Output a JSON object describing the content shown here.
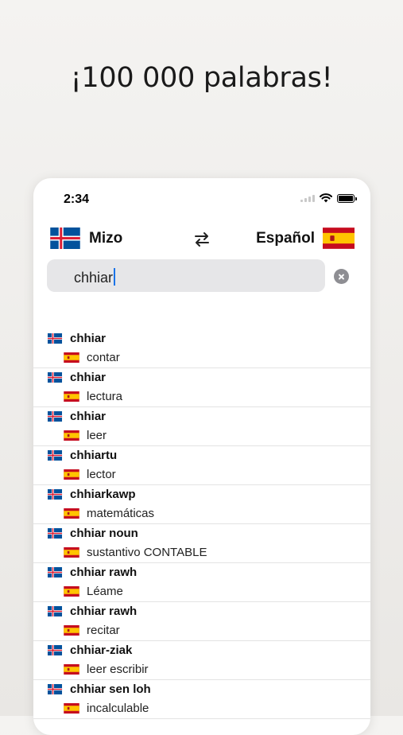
{
  "headline": "¡100 000 palabras!",
  "status_bar": {
    "time": "2:34"
  },
  "languages": {
    "source": "Mizo",
    "target": "Español"
  },
  "search": {
    "value": "chhiar"
  },
  "results": [
    {
      "word": "chhiar",
      "translation": "contar"
    },
    {
      "word": "chhiar",
      "translation": "lectura"
    },
    {
      "word": "chhiar",
      "translation": "leer"
    },
    {
      "word": "chhiartu",
      "translation": "lector"
    },
    {
      "word": "chhiarkawp",
      "translation": "matemáticas"
    },
    {
      "word": "chhiar noun",
      "translation": "sustantivo CONTABLE"
    },
    {
      "word": "chhiar rawh",
      "translation": "Léame"
    },
    {
      "word": "chhiar rawh",
      "translation": "recitar"
    },
    {
      "word": "chhiar-ziak",
      "translation": "leer escribir"
    },
    {
      "word": "chhiar sen loh",
      "translation": "incalculable"
    }
  ],
  "icons": {
    "source_flag": "iceland-flag-icon",
    "target_flag": "spain-flag-icon",
    "swap": "swap-arrows-icon",
    "clear": "clear-circle-icon",
    "wifi": "wifi-icon",
    "battery": "battery-icon"
  },
  "colors": {
    "accent_caret": "#1a73e8",
    "search_bg": "#e6e6e8",
    "spain_red": "#c60b1e",
    "spain_yellow": "#ffc400",
    "iceland_blue": "#02529c",
    "iceland_red": "#dc1e35"
  }
}
